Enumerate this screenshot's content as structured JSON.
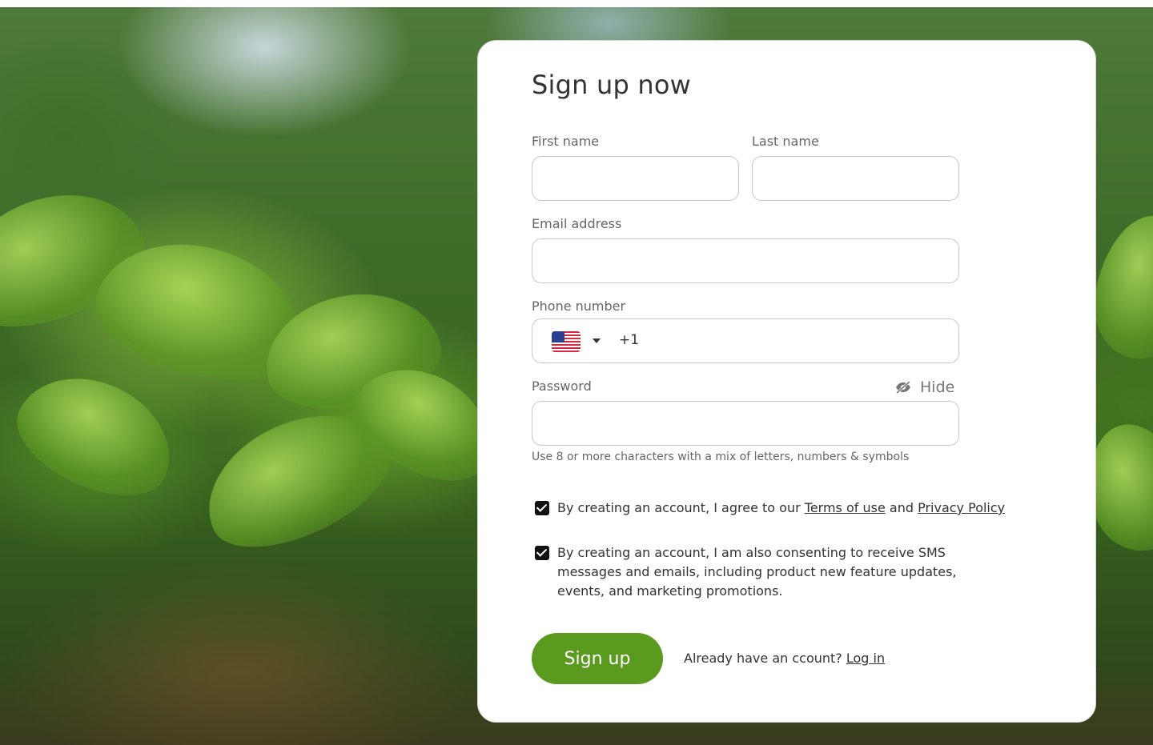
{
  "form": {
    "title": "Sign up now",
    "first_name_label": "First name",
    "last_name_label": "Last name",
    "email_label": "Email address",
    "phone_label": "Phone number",
    "phone_country_icon": "us-flag-icon",
    "phone_dial_code": "+1",
    "password_label": "Password",
    "hide_label": "Hide",
    "hide_icon": "eye-slash-icon",
    "password_hint": "Use 8 or more characters with a mix of letters, numbers & symbols",
    "first_name_value": "",
    "last_name_value": "",
    "email_value": "",
    "phone_value": "",
    "password_value": ""
  },
  "consents": {
    "terms_prefix": "By creating an account, I agree to our",
    "terms_link": "Terms of use",
    "terms_and": "and",
    "privacy_link": "Privacy Policy",
    "terms_checked": true,
    "sms_text": "By creating an account, I am also consenting to receive SMS messages and emails, including product new feature updates, events, and marketing promotions.",
    "sms_checked": true
  },
  "footer": {
    "signup_button": "Sign up",
    "login_prompt": "Already have an ccount?",
    "login_link": "Log in"
  },
  "colors": {
    "accent": "#5a9a1f",
    "checkbox": "#111111"
  }
}
